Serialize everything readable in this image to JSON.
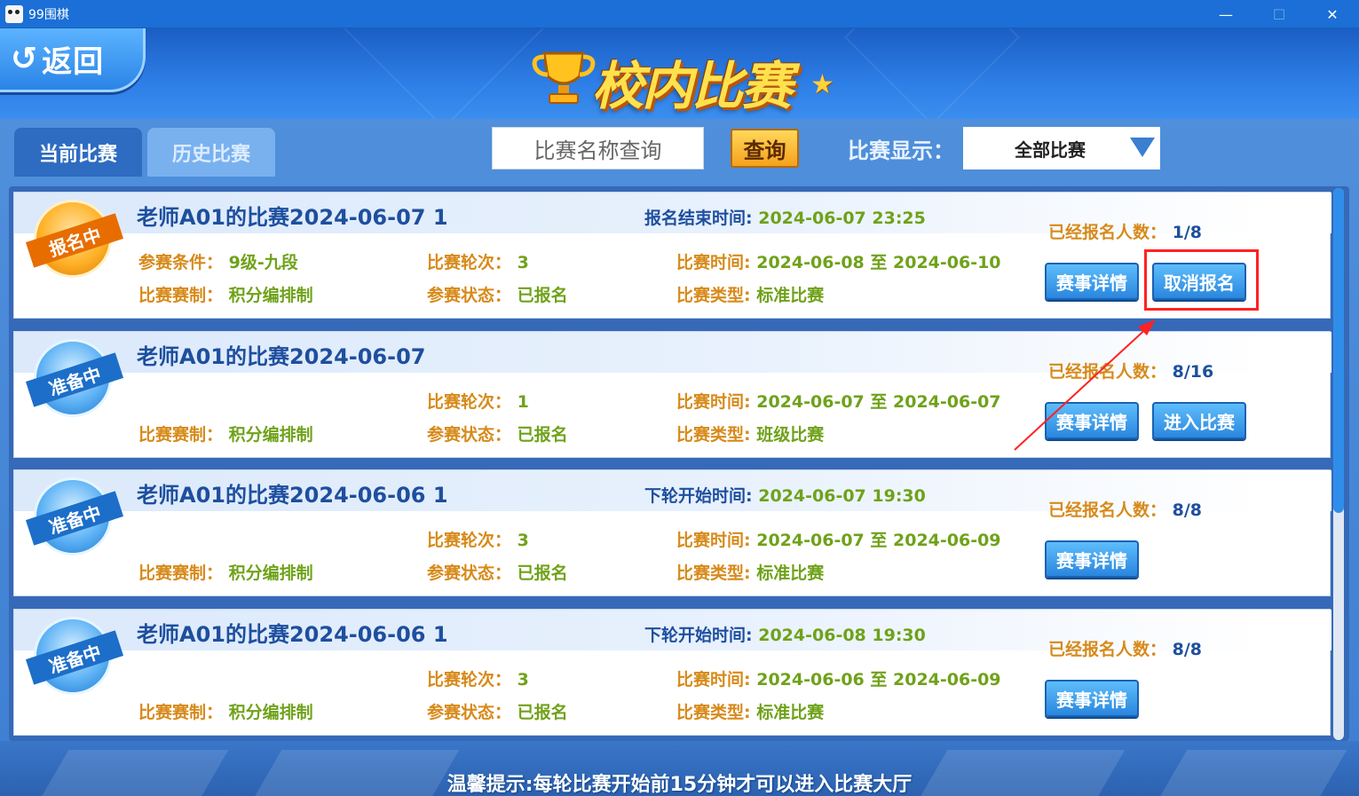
{
  "window": {
    "title": "99围棋",
    "minimize": "—",
    "maximize": "☐",
    "close": "✕"
  },
  "header": {
    "back_label": "返回",
    "back_arrow": "↺",
    "title": "校内比赛",
    "star": "★"
  },
  "tabs": [
    {
      "label": "当前比赛",
      "active": true
    },
    {
      "label": "历史比赛",
      "active": false
    }
  ],
  "search": {
    "placeholder": "比赛名称查询",
    "button_label": "查询"
  },
  "filter": {
    "label": "比赛显示：",
    "selected": "全部比赛"
  },
  "matches": [
    {
      "badge": "报名中",
      "title": "老师A01的比赛2024-06-07 1",
      "time_label": "报名结束时间:",
      "time_value": "2024-06-07 23:25",
      "condition_label": "参赛条件：",
      "condition_value": "9级-九段",
      "rounds_label": "比赛轮次：",
      "rounds_value": "3",
      "period_label": "比赛时间:",
      "period_value": "2024-06-08 至 2024-06-10",
      "system_label": "比赛赛制：",
      "system_value": "积分编排制",
      "status_label": "参赛状态：",
      "status_value": "已报名",
      "type_label": "比赛类型:",
      "type_value": "标准比赛",
      "count_label": "已经报名人数：",
      "count_value": "1/8",
      "detail_button": "赛事详情",
      "action_button": "取消报名"
    },
    {
      "badge": "准备中",
      "title": "老师A01的比赛2024-06-07",
      "rounds_label": "比赛轮次：",
      "rounds_value": "1",
      "period_label": "比赛时间:",
      "period_value": "2024-06-07 至 2024-06-07",
      "system_label": "比赛赛制：",
      "system_value": "积分编排制",
      "status_label": "参赛状态：",
      "status_value": "已报名",
      "type_label": "比赛类型:",
      "type_value": "班级比赛",
      "count_label": "已经报名人数：",
      "count_value": "8/16",
      "detail_button": "赛事详情",
      "action_button": "进入比赛"
    },
    {
      "badge": "准备中",
      "title": "老师A01的比赛2024-06-06 1",
      "time_label": "下轮开始时间:",
      "time_value": "2024-06-07 19:30",
      "rounds_label": "比赛轮次：",
      "rounds_value": "3",
      "period_label": "比赛时间:",
      "period_value": "2024-06-07 至 2024-06-09",
      "system_label": "比赛赛制：",
      "system_value": "积分编排制",
      "status_label": "参赛状态：",
      "status_value": "已报名",
      "type_label": "比赛类型:",
      "type_value": "标准比赛",
      "count_label": "已经报名人数：",
      "count_value": "8/8",
      "detail_button": "赛事详情"
    },
    {
      "badge": "准备中",
      "title": "老师A01的比赛2024-06-06 1",
      "time_label": "下轮开始时间:",
      "time_value": "2024-06-08 19:30",
      "rounds_label": "比赛轮次：",
      "rounds_value": "3",
      "period_label": "比赛时间:",
      "period_value": "2024-06-06 至 2024-06-09",
      "system_label": "比赛赛制：",
      "system_value": "积分编排制",
      "status_label": "参赛状态：",
      "status_value": "已报名",
      "type_label": "比赛类型:",
      "type_value": "标准比赛",
      "count_label": "已经报名人数：",
      "count_value": "8/8",
      "detail_button": "赛事详情"
    }
  ],
  "footer": {
    "tip": "温馨提示:每轮比赛开始前15分钟才可以进入比赛大厅"
  },
  "colors": {
    "accent_blue": "#2a86de",
    "label_orange": "#d78a1a",
    "value_green": "#6fa21a",
    "title_blue": "#1e4f9e",
    "highlight_red": "#ff2222"
  }
}
